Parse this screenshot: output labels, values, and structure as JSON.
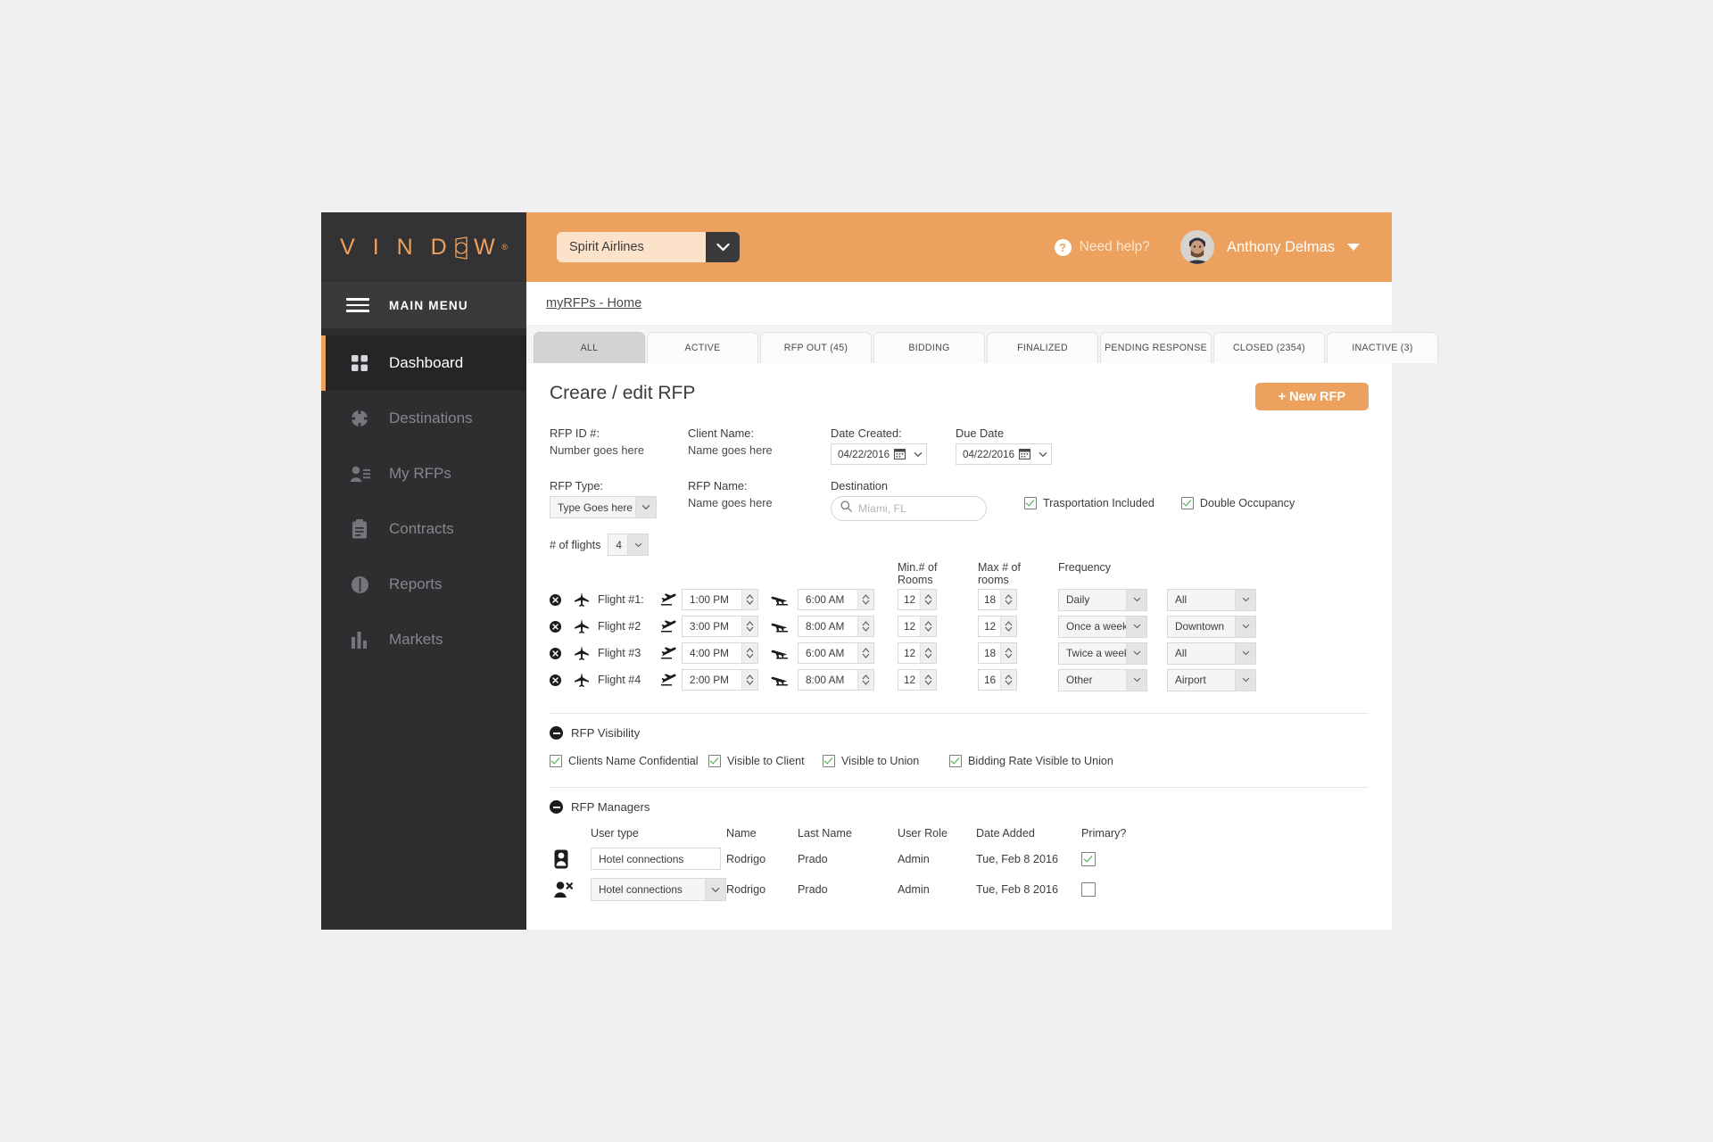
{
  "brand": {
    "name": "VINDOW",
    "letters_before": "V I N D",
    "letters_after": "W",
    "trademark": "®"
  },
  "sidebar": {
    "main_menu_label": "MAIN MENU",
    "items": [
      {
        "label": "Dashboard",
        "icon": "grid-icon",
        "active": true
      },
      {
        "label": "Destinations",
        "icon": "compass-icon",
        "active": false
      },
      {
        "label": "My RFPs",
        "icon": "user-list-icon",
        "active": false
      },
      {
        "label": "Contracts",
        "icon": "clipboard-icon",
        "active": false
      },
      {
        "label": "Reports",
        "icon": "pie-chart-icon",
        "active": false
      },
      {
        "label": "Markets",
        "icon": "bar-chart-icon",
        "active": false
      }
    ]
  },
  "topbar": {
    "company": "Spirit Airlines",
    "need_help": "Need help?",
    "user_name": "Anthony Delmas",
    "help_icon": "question-mark-icon",
    "avatar_icon": "user-avatar",
    "caret_icon": "chevron-down-icon"
  },
  "breadcrumb": {
    "text": "myRFPs - Home"
  },
  "tabs": [
    {
      "label": "ALL",
      "active": true
    },
    {
      "label": "ACTIVE",
      "active": false
    },
    {
      "label": "RFP OUT (45)",
      "active": false
    },
    {
      "label": "BIDDING",
      "active": false
    },
    {
      "label": "FINALIZED",
      "active": false
    },
    {
      "label": "PENDING RESPONSE",
      "active": false
    },
    {
      "label": "CLOSED (2354)",
      "active": false
    },
    {
      "label": "INACTIVE (3)",
      "active": false
    }
  ],
  "main": {
    "page_title": "Creare / edit RFP",
    "new_rfp_button": "+ New RFP",
    "fields": {
      "rfp_id_label": "RFP ID #:",
      "rfp_id_value": "Number goes here",
      "client_name_label": "Client Name:",
      "client_name_value": "Name goes here",
      "date_created_label": "Date Created:",
      "date_created_value": "04/22/2016",
      "due_date_label": "Due Date",
      "due_date_value": "04/22/2016",
      "rfp_type_label": "RFP Type:",
      "rfp_type_value": "Type Goes here",
      "rfp_name_label": "RFP Name:",
      "rfp_name_value": "Name goes here",
      "destination_label": "Destination",
      "destination_placeholder": "Miami, FL",
      "transportation_label": "Trasportation Included",
      "transportation_checked": true,
      "double_occupancy_label": "Double Occupancy",
      "double_occupancy_checked": true
    },
    "flights": {
      "count_label": "# of flights",
      "count_value": "4",
      "headers": {
        "min_rooms": "Min.# of Rooms",
        "max_rooms": "Max # of rooms",
        "frequency": "Frequency"
      },
      "rows": [
        {
          "name": "Flight #1:",
          "depart_time": "1:00 PM",
          "arrive_time": "6:00 AM",
          "min_rooms": "12",
          "max_rooms": "18",
          "frequency": "Daily",
          "area": "All"
        },
        {
          "name": "Flight #2",
          "depart_time": "3:00 PM",
          "arrive_time": "8:00 AM",
          "min_rooms": "12",
          "max_rooms": "12",
          "frequency": "Once a week",
          "area": "Downtown"
        },
        {
          "name": "Flight #3",
          "depart_time": "4:00 PM",
          "arrive_time": "6:00 AM",
          "min_rooms": "12",
          "max_rooms": "18",
          "frequency": "Twice a week",
          "area": "All"
        },
        {
          "name": "Flight #4",
          "depart_time": "2:00 PM",
          "arrive_time": "8:00 AM",
          "min_rooms": "12",
          "max_rooms": "16",
          "frequency": "Other",
          "area": "Airport"
        }
      ]
    },
    "visibility": {
      "section_title": "RFP Visibility",
      "options": [
        {
          "label": "Clients Name Confidential",
          "checked": true
        },
        {
          "label": "Visible to Client",
          "checked": true
        },
        {
          "label": "Visible to Union",
          "checked": true
        },
        {
          "label": "Bidding Rate Visible to Union",
          "checked": true
        }
      ]
    },
    "managers": {
      "section_title": "RFP Managers",
      "headers": {
        "user_type": "User type",
        "name": "Name",
        "last_name": "Last Name",
        "user_role": "User Role",
        "date_added": "Date Added",
        "primary": "Primary?"
      },
      "rows": [
        {
          "icon": "user-icon",
          "user_type": "Hotel connections",
          "type_is_select": false,
          "name": "Rodrigo",
          "last_name": "Prado",
          "user_role": "Admin",
          "date_added": "Tue, Feb 8 2016",
          "primary": true
        },
        {
          "icon": "user-remove-icon",
          "user_type": "Hotel connections",
          "type_is_select": true,
          "name": "Rodrigo",
          "last_name": "Prado",
          "user_role": "Admin",
          "date_added": "Tue, Feb 8 2016",
          "primary": false
        }
      ]
    }
  },
  "colors": {
    "accent_orange": "#eda15e",
    "sidebar_dark": "#2e2e30",
    "sidebar_active": "#252528",
    "page_bg": "#f0f0f0",
    "check_green": "#3aa93a"
  }
}
